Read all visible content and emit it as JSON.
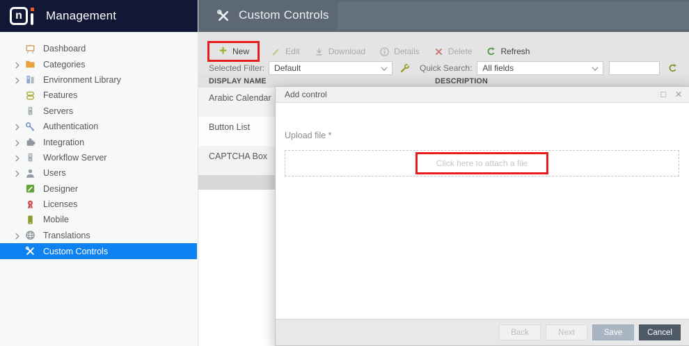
{
  "app": {
    "brand": "Management",
    "logo": {
      "letter": "n",
      "dot_color": "#f05a28"
    }
  },
  "colors": {
    "sidebar_dark": "#111735",
    "selected_blue": "#0f82f2",
    "header_slate": "#5c6975",
    "toolbar_gray": "#e4e4e4",
    "highlight_red": "#e81c1c",
    "olive_accent": "#a3a72e",
    "refresh_green": "#5f9b3c"
  },
  "sidebar": {
    "items": [
      {
        "label": "Dashboard",
        "icon": "dashboard-icon",
        "expandable": false,
        "selected": false
      },
      {
        "label": "Categories",
        "icon": "folder-icon",
        "expandable": true,
        "selected": false
      },
      {
        "label": "Environment Library",
        "icon": "library-icon",
        "expandable": true,
        "selected": false
      },
      {
        "label": "Features",
        "icon": "features-icon",
        "expandable": false,
        "selected": false
      },
      {
        "label": "Servers",
        "icon": "server-icon",
        "expandable": false,
        "selected": false
      },
      {
        "label": "Authentication",
        "icon": "key-icon",
        "expandable": true,
        "selected": false
      },
      {
        "label": "Integration",
        "icon": "puzzle-icon",
        "expandable": true,
        "selected": false
      },
      {
        "label": "Workflow Server",
        "icon": "server-icon",
        "expandable": true,
        "selected": false
      },
      {
        "label": "Users",
        "icon": "user-icon",
        "expandable": true,
        "selected": false
      },
      {
        "label": "Designer",
        "icon": "designer-icon",
        "expandable": false,
        "selected": false
      },
      {
        "label": "Licenses",
        "icon": "ribbon-icon",
        "expandable": false,
        "selected": false
      },
      {
        "label": "Mobile",
        "icon": "mobile-icon",
        "expandable": false,
        "selected": false
      },
      {
        "label": "Translations",
        "icon": "globe-icon",
        "expandable": true,
        "selected": false
      },
      {
        "label": "Custom Controls",
        "icon": "tools-icon",
        "expandable": false,
        "selected": true
      }
    ]
  },
  "header": {
    "title": "Custom Controls",
    "icon": "tools-icon"
  },
  "toolbar": {
    "buttons": [
      {
        "label": "New",
        "icon": "plus-icon",
        "enabled": true,
        "highlighted": true
      },
      {
        "label": "Edit",
        "icon": "pencil-icon",
        "enabled": false,
        "highlighted": false
      },
      {
        "label": "Download",
        "icon": "download-icon",
        "enabled": false,
        "highlighted": false
      },
      {
        "label": "Details",
        "icon": "info-icon",
        "enabled": false,
        "highlighted": false
      },
      {
        "label": "Delete",
        "icon": "delete-icon",
        "enabled": false,
        "highlighted": false
      },
      {
        "label": "Refresh",
        "icon": "refresh-icon",
        "enabled": true,
        "highlighted": false
      }
    ],
    "filter": {
      "label": "Selected Filter:",
      "value": "Default",
      "settings_icon": "wrench-icon"
    },
    "quick_search": {
      "label": "Quick Search:",
      "value": "All fields",
      "input_value": "",
      "refresh_icon": "refresh-icon"
    }
  },
  "table": {
    "columns": [
      "DISPLAY NAME",
      "DESCRIPTION"
    ],
    "rows": [
      {
        "display_name": "Arabic Calendar",
        "description": ""
      },
      {
        "display_name": "Button List",
        "description": ""
      },
      {
        "display_name": "CAPTCHA Box",
        "description": ""
      }
    ]
  },
  "modal": {
    "title": "Add control",
    "window_icons": [
      {
        "name": "maximize-icon",
        "glyph": "□"
      },
      {
        "name": "close-icon",
        "glyph": "×"
      }
    ],
    "upload_label": "Upload file *",
    "attach_text": "Click here to attach a file",
    "footer_buttons": [
      {
        "label": "Back",
        "enabled": false,
        "variant": "ghost"
      },
      {
        "label": "Next",
        "enabled": false,
        "variant": "ghost"
      },
      {
        "label": "Save",
        "enabled": true,
        "variant": "primary-muted"
      },
      {
        "label": "Cancel",
        "enabled": true,
        "variant": "dark"
      }
    ]
  }
}
